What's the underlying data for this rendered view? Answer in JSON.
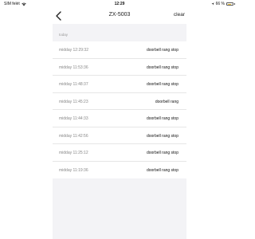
{
  "status_bar": {
    "carrier": "SIM felét",
    "time": "12:29",
    "battery_text": "66 %",
    "battery_level": 0.66,
    "battery_color": "#f4c430"
  },
  "nav": {
    "back_icon": "chevron-left-icon",
    "title": "ZX-5003",
    "clear_label": "clear"
  },
  "section": {
    "label": "today"
  },
  "events": [
    {
      "time": "midday  12:29:32",
      "event": "doorbell rang stop"
    },
    {
      "time": "midday  11:53:36",
      "event": "doorbell rang stop"
    },
    {
      "time": "midday  11:48:37",
      "event": "doorbell rang stop"
    },
    {
      "time": "midday  11:45:23",
      "event": "doorbell rang"
    },
    {
      "time": "midday  11:44:33",
      "event": "doorbell rang stop"
    },
    {
      "time": "midday  11:42:56",
      "event": "doorbell rang stop"
    },
    {
      "time": "midday  11:25:12",
      "event": "doorbell rang stop"
    },
    {
      "time": "midday  11:19:36",
      "event": "doorbell rang stop"
    }
  ]
}
